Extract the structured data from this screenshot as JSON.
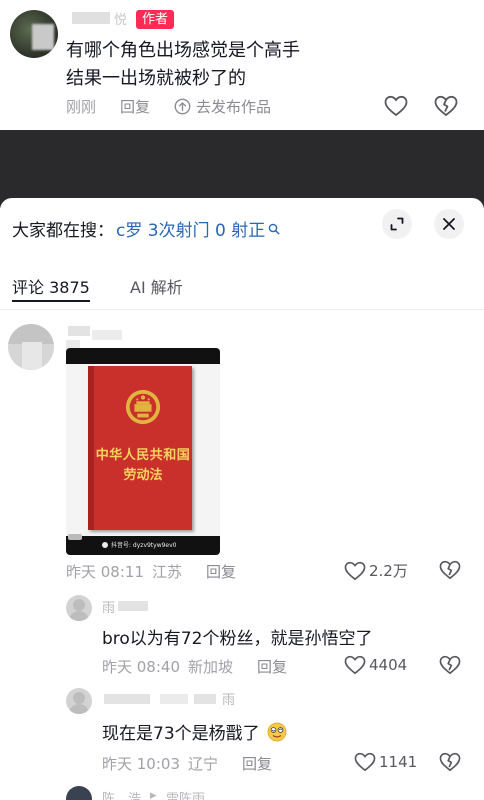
{
  "top_comment": {
    "name_tail": "悦",
    "author_badge": "作者",
    "text_line1": "有哪个角色出场感觉是个高手",
    "text_line2": "结果一出场就被秒了的",
    "time": "刚刚",
    "reply_label": "回复",
    "publish_label": "去发布作品"
  },
  "search_bar": {
    "prefix": "大家都在搜：",
    "query": "c罗 3次射门 0 射正"
  },
  "tabs": [
    {
      "label": "评论 3875"
    },
    {
      "label": "AI 解析"
    }
  ],
  "comment1": {
    "media": {
      "book_title": "中华人民共和国",
      "book_subtitle": "劳动法",
      "watermark": "抖音号: dyzv9tyw9ev0"
    },
    "time": "昨天 08:11",
    "location": "江苏",
    "reply_label": "回复",
    "likes": "2.2万"
  },
  "reply1": {
    "name_visible": "雨",
    "text": "bro以为有72个粉丝，就是孙悟空了",
    "time": "昨天 08:40",
    "location": "新加坡",
    "reply_label": "回复",
    "likes": "4404"
  },
  "reply2": {
    "name_tail": "雨",
    "text": "现在是73个是杨戬了",
    "time": "昨天 10:03",
    "location": "辽宁",
    "reply_label": "回复",
    "likes": "1141"
  },
  "reply3": {
    "name": "陈，浩",
    "reply_to": "雷陈雨"
  },
  "colors": {
    "accent": "#fe2c55",
    "link": "#2867b5",
    "text": "#161823",
    "meta": "#a1a2a7"
  }
}
